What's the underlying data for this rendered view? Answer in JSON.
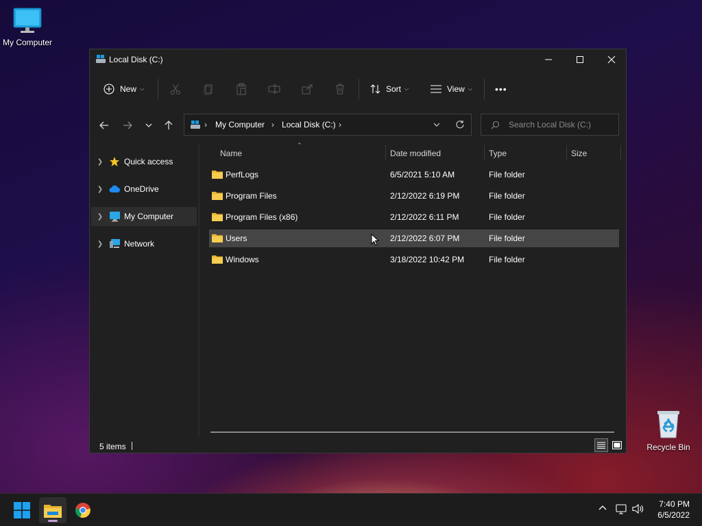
{
  "desktop": {
    "icons": [
      {
        "label": "My Computer",
        "icon": "monitor-icon"
      },
      {
        "label": "Recycle Bin",
        "icon": "recycle-bin-icon"
      }
    ]
  },
  "window": {
    "title": "Local Disk (C:)",
    "controls": {
      "minimize": "minimize-icon",
      "maximize": "maximize-icon",
      "close": "close-icon"
    }
  },
  "toolbar": {
    "new_label": "New",
    "sort_label": "Sort",
    "view_label": "View",
    "more_label": "•••"
  },
  "address": {
    "crumbs": [
      "My Computer",
      "Local Disk (C:)"
    ],
    "search_placeholder": "Search Local Disk (C:)"
  },
  "nav_pane": {
    "items": [
      {
        "label": "Quick access",
        "icon": "star-icon"
      },
      {
        "label": "OneDrive",
        "icon": "cloud-icon"
      },
      {
        "label": "My Computer",
        "icon": "monitor-icon",
        "selected": true
      },
      {
        "label": "Network",
        "icon": "network-icon"
      }
    ]
  },
  "file_list": {
    "columns": [
      "Name",
      "Date modified",
      "Type",
      "Size"
    ],
    "rows": [
      {
        "name": "PerfLogs",
        "date": "6/5/2021 5:10 AM",
        "type": "File folder",
        "size": ""
      },
      {
        "name": "Program Files",
        "date": "2/12/2022 6:19 PM",
        "type": "File folder",
        "size": ""
      },
      {
        "name": "Program Files (x86)",
        "date": "2/12/2022 6:11 PM",
        "type": "File folder",
        "size": ""
      },
      {
        "name": "Users",
        "date": "2/12/2022 6:07 PM",
        "type": "File folder",
        "size": "",
        "selected": true
      },
      {
        "name": "Windows",
        "date": "3/18/2022 10:42 PM",
        "type": "File folder",
        "size": ""
      }
    ]
  },
  "status": {
    "items_count": "5 items"
  },
  "taskbar": {
    "clock_time": "7:40 PM",
    "clock_date": "6/5/2022",
    "apps": [
      "start-icon",
      "file-explorer-icon",
      "chrome-icon"
    ]
  },
  "colors": {
    "accent": "#0078d4",
    "folder": "#f2c94c",
    "window_bg": "#202020"
  }
}
